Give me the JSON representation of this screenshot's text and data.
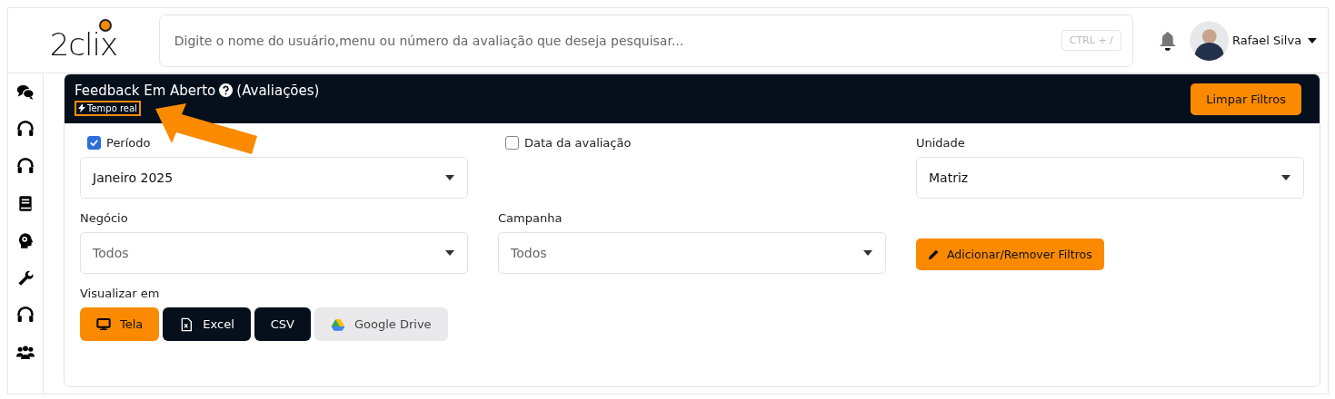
{
  "header": {
    "logo": "2clix",
    "search": {
      "placeholder": "Digite o nome do usuário,menu ou número da avaliação que deseja pesquisar...",
      "shortcut": "CTRL + /"
    },
    "user": {
      "name": "Rafael Silva"
    }
  },
  "panel": {
    "title": "Feedback Em Aberto",
    "subtitle": "(Avaliações)",
    "badge": {
      "label": "Tempo real",
      "highlighted": true
    },
    "clear_button": "Limpar Filtros"
  },
  "filters": [
    {
      "kind": "checkbox-select",
      "label": "Período",
      "checked": true,
      "value": "Janeiro 2025"
    },
    {
      "kind": "checkbox",
      "label": "Data da avaliação",
      "checked": false
    },
    {
      "kind": "select",
      "label": "Unidade",
      "value": "Matriz"
    },
    {
      "kind": "select",
      "label": "Negócio",
      "placeholder": "Todos"
    },
    {
      "kind": "select",
      "label": "Campanha",
      "placeholder": "Todos"
    },
    {
      "kind": "button",
      "label": "Adicionar/Remover Filtros"
    }
  ],
  "view": {
    "label": "Visualizar em",
    "options": [
      {
        "label": "Tela",
        "kind": "dark",
        "selected": true
      },
      {
        "label": "Excel",
        "kind": "dark",
        "selected": false
      },
      {
        "label": "CSV",
        "kind": "dark",
        "selected": false
      },
      {
        "label": "Google Drive",
        "kind": "light",
        "selected": false
      }
    ]
  }
}
